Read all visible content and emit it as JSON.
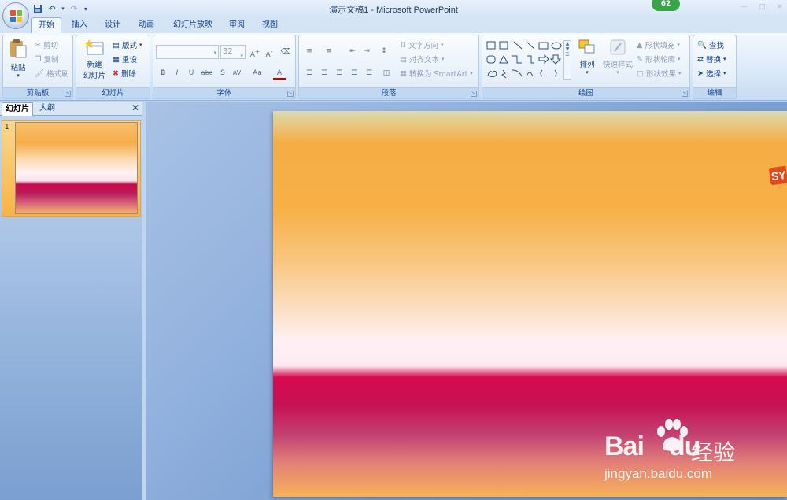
{
  "title_bar": {
    "window_title": "演示文稿1 - Microsoft PowerPoint",
    "notification_badge": "62",
    "controls": [
      "—",
      "□",
      "✕"
    ]
  },
  "quick_access": {
    "icons": [
      "save-icon",
      "undo-icon",
      "redo-icon",
      "customize-icon"
    ]
  },
  "tabs": [
    {
      "label": "开始",
      "active": true
    },
    {
      "label": "插入"
    },
    {
      "label": "设计"
    },
    {
      "label": "动画"
    },
    {
      "label": "幻灯片放映"
    },
    {
      "label": "审阅"
    },
    {
      "label": "视图"
    }
  ],
  "ribbon": {
    "clipboard": {
      "label": "剪贴板",
      "paste": "粘贴",
      "cut": "剪切",
      "copy": "复制",
      "format_painter": "格式刷"
    },
    "slides": {
      "label": "幻灯片",
      "new_slide_line1": "新建",
      "new_slide_line2": "幻灯片",
      "layout": "版式",
      "reset": "重设",
      "delete": "删除"
    },
    "font": {
      "label": "字体",
      "font_name": "",
      "font_size": "32"
    },
    "paragraph": {
      "label": "段落",
      "text_direction": "文字方向",
      "align_text": "对齐文本",
      "convert_smartart": "转换为 SmartArt"
    },
    "drawing": {
      "label": "绘图",
      "arrange": "排列",
      "quick_styles": "快速样式",
      "shape_fill": "形状填充",
      "shape_outline": "形状轮廓",
      "shape_effects": "形状效果"
    },
    "editing": {
      "label": "编辑",
      "find": "查找",
      "replace": "替换",
      "select": "选择"
    }
  },
  "left_panel": {
    "tab_slides": "幻灯片",
    "tab_outline": "大纲",
    "close": "✕",
    "slide_number": "1"
  },
  "watermark": {
    "brand": "Bai",
    "brand_tail": "du",
    "cn": "经验",
    "url": "jingyan.baidu.com"
  },
  "colors": {
    "ribbon_text": "#15428b",
    "slide_orange": "#f5ae46",
    "slide_magenta": "#d70a4f"
  }
}
